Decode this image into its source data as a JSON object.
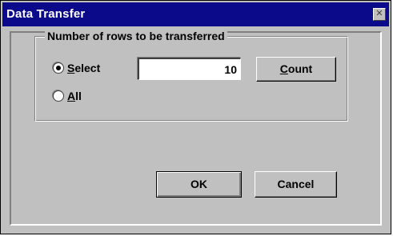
{
  "window": {
    "title": "Data Transfer",
    "close_glyph": "✕"
  },
  "group": {
    "legend": "Number of rows to be transferred"
  },
  "options": {
    "select": {
      "mnemonic": "S",
      "rest": "elect",
      "selected": true
    },
    "all": {
      "mnemonic": "A",
      "rest": "ll",
      "selected": false
    }
  },
  "rows_field": {
    "value": "10"
  },
  "buttons": {
    "count": {
      "mnemonic": "C",
      "rest": "ount"
    },
    "ok": {
      "label": "OK"
    },
    "cancel": {
      "label": "Cancel"
    }
  },
  "colors": {
    "titlebar": "#0b0a8a",
    "face": "#c0c0c0"
  },
  "icons": {
    "close": "close-icon"
  }
}
